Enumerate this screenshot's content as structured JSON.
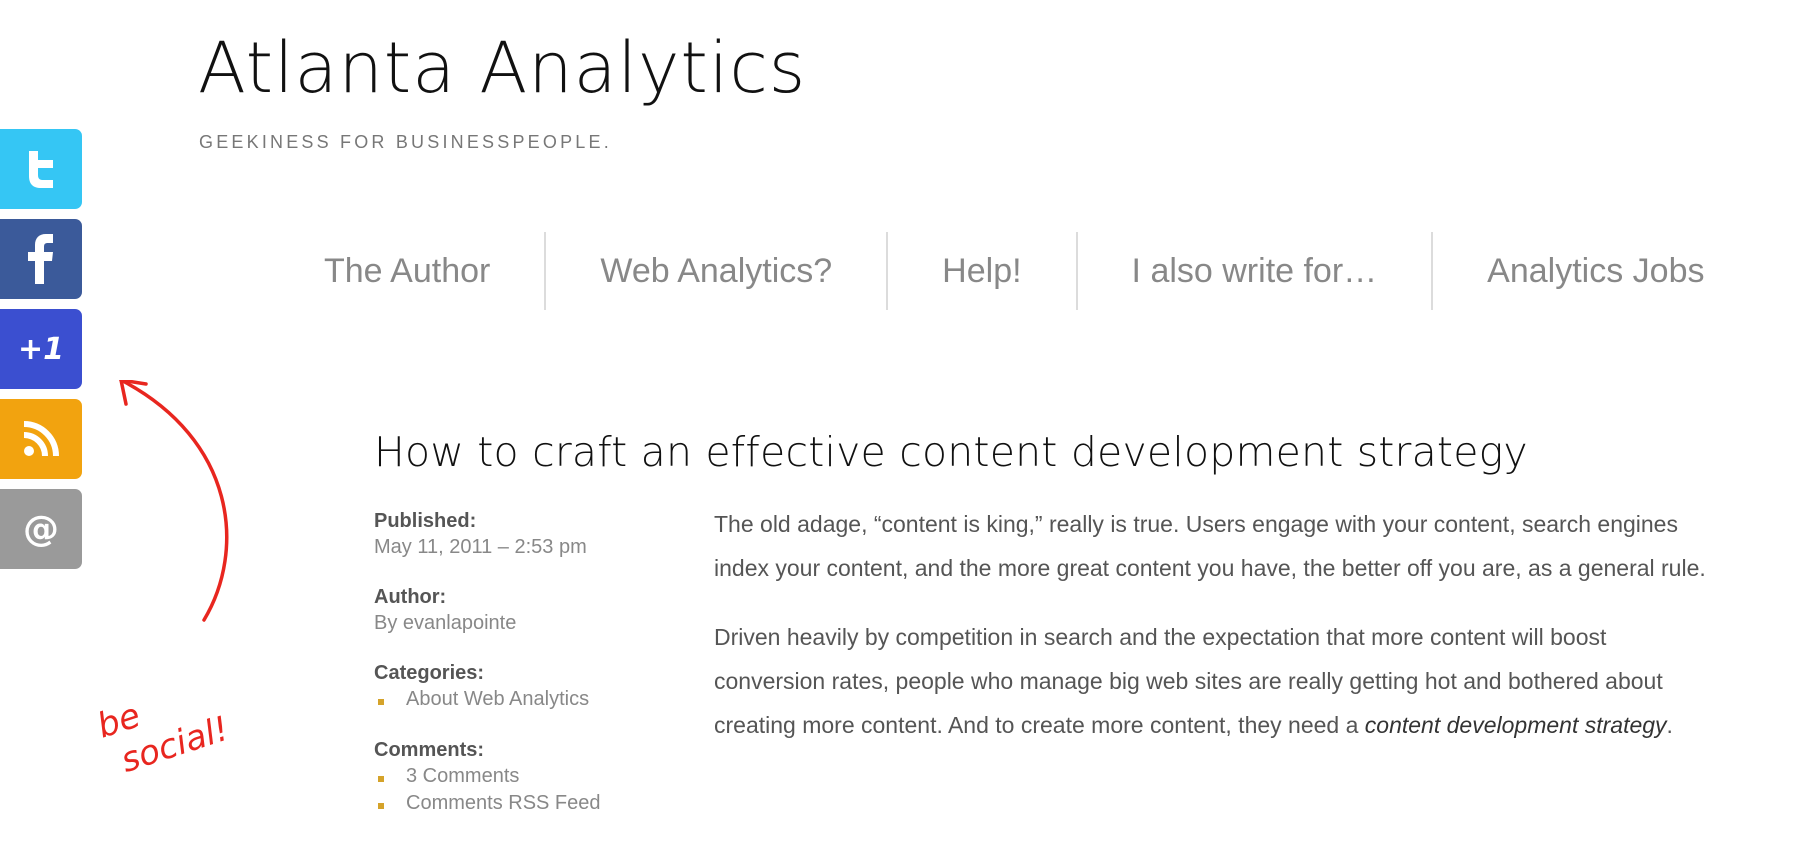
{
  "site": {
    "title": "Atlanta Analytics",
    "tagline": "GEEKINESS FOR BUSINESSPEOPLE."
  },
  "social": {
    "buttons": [
      {
        "name": "twitter",
        "icon": "twitter-icon",
        "color": "#35c6f4"
      },
      {
        "name": "facebook",
        "icon": "facebook-icon",
        "color": "#3b5a9a"
      },
      {
        "name": "google-plus-one",
        "icon": "plus-one-icon",
        "color": "#3b4fd0",
        "label": "+1"
      },
      {
        "name": "rss",
        "icon": "rss-icon",
        "color": "#f2a30f"
      },
      {
        "name": "email",
        "icon": "at-icon",
        "color": "#9a9a9a",
        "label": "@"
      }
    ],
    "annotation": "be social!",
    "annotation_color": "#e8261f"
  },
  "nav": {
    "items": [
      {
        "label": "The Author"
      },
      {
        "label": "Web Analytics?"
      },
      {
        "label": "Help!"
      },
      {
        "label": "I also write for…"
      },
      {
        "label": "Analytics Jobs"
      }
    ]
  },
  "post": {
    "title": "How to craft an effective content development strategy",
    "meta": {
      "published_label": "Published:",
      "published_value": "May 11, 2011 – 2:53 pm",
      "author_label": "Author:",
      "author_value": "By evanlapointe",
      "categories_label": "Categories:",
      "categories": [
        "About Web Analytics"
      ],
      "comments_label": "Comments:",
      "comments_links": [
        "3 Comments",
        "Comments RSS Feed"
      ],
      "bullet_color": "#d5a32a"
    },
    "paragraphs": [
      {
        "text": "The old adage, “content is king,” really is true. Users engage with your content, search engines index your content, and the more great content you have, the better off you are, as a general rule."
      },
      {
        "text_before": "Driven heavily by competition in search and the expectation that more content will boost conversion rates, people who manage big web sites are really getting hot and bothered about creating more content. And to create more content, they need a ",
        "emphasis": "content development strategy",
        "text_after": "."
      }
    ]
  }
}
